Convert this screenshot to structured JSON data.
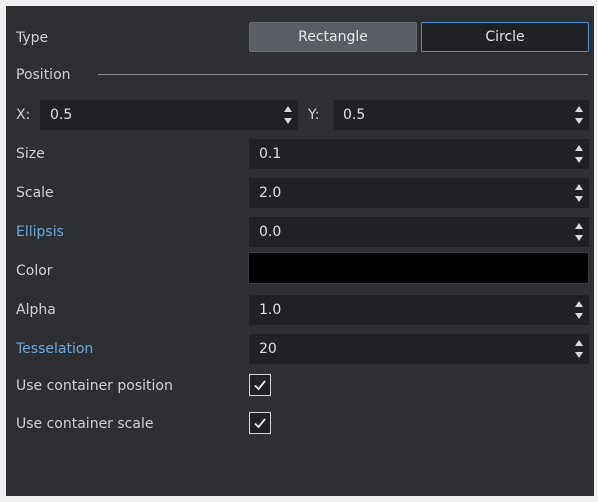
{
  "type": {
    "label": "Type",
    "options": [
      "Rectangle",
      "Circle"
    ],
    "selected": "Circle"
  },
  "position": {
    "label": "Position",
    "x_label": "X:",
    "x_value": "0.5",
    "y_label": "Y:",
    "y_value": "0.5"
  },
  "fields": {
    "size": {
      "label": "Size",
      "value": "0.1"
    },
    "scale": {
      "label": "Scale",
      "value": "2.0"
    },
    "ellipsis": {
      "label": "Ellipsis",
      "value": "0.0"
    },
    "color": {
      "label": "Color",
      "value": "#000000"
    },
    "alpha": {
      "label": "Alpha",
      "value": "1.0"
    },
    "tesselation": {
      "label": "Tesselation",
      "value": "20"
    }
  },
  "checks": {
    "use_container_position": {
      "label": "Use container position",
      "checked": true
    },
    "use_container_scale": {
      "label": "Use container scale",
      "checked": true
    }
  },
  "colors": {
    "panel_bg": "#2d2f33",
    "field_bg": "#1f2124",
    "accent_label": "#6fa7d8",
    "selected_border": "#4f8fd0"
  }
}
